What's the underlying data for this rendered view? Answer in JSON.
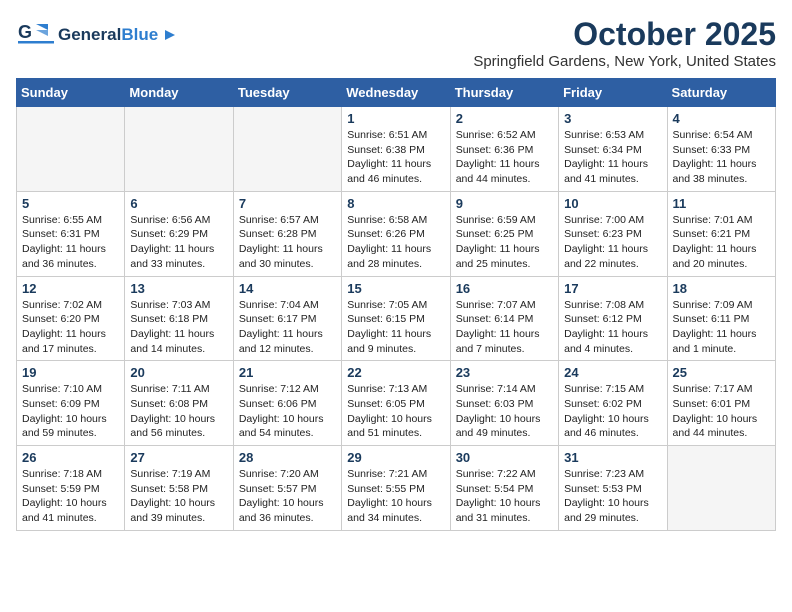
{
  "header": {
    "logo_line1": "General",
    "logo_line2": "Blue",
    "month": "October 2025",
    "location": "Springfield Gardens, New York, United States"
  },
  "weekdays": [
    "Sunday",
    "Monday",
    "Tuesday",
    "Wednesday",
    "Thursday",
    "Friday",
    "Saturday"
  ],
  "weeks": [
    [
      {
        "day": "",
        "info": ""
      },
      {
        "day": "",
        "info": ""
      },
      {
        "day": "",
        "info": ""
      },
      {
        "day": "1",
        "info": "Sunrise: 6:51 AM\nSunset: 6:38 PM\nDaylight: 11 hours\nand 46 minutes."
      },
      {
        "day": "2",
        "info": "Sunrise: 6:52 AM\nSunset: 6:36 PM\nDaylight: 11 hours\nand 44 minutes."
      },
      {
        "day": "3",
        "info": "Sunrise: 6:53 AM\nSunset: 6:34 PM\nDaylight: 11 hours\nand 41 minutes."
      },
      {
        "day": "4",
        "info": "Sunrise: 6:54 AM\nSunset: 6:33 PM\nDaylight: 11 hours\nand 38 minutes."
      }
    ],
    [
      {
        "day": "5",
        "info": "Sunrise: 6:55 AM\nSunset: 6:31 PM\nDaylight: 11 hours\nand 36 minutes."
      },
      {
        "day": "6",
        "info": "Sunrise: 6:56 AM\nSunset: 6:29 PM\nDaylight: 11 hours\nand 33 minutes."
      },
      {
        "day": "7",
        "info": "Sunrise: 6:57 AM\nSunset: 6:28 PM\nDaylight: 11 hours\nand 30 minutes."
      },
      {
        "day": "8",
        "info": "Sunrise: 6:58 AM\nSunset: 6:26 PM\nDaylight: 11 hours\nand 28 minutes."
      },
      {
        "day": "9",
        "info": "Sunrise: 6:59 AM\nSunset: 6:25 PM\nDaylight: 11 hours\nand 25 minutes."
      },
      {
        "day": "10",
        "info": "Sunrise: 7:00 AM\nSunset: 6:23 PM\nDaylight: 11 hours\nand 22 minutes."
      },
      {
        "day": "11",
        "info": "Sunrise: 7:01 AM\nSunset: 6:21 PM\nDaylight: 11 hours\nand 20 minutes."
      }
    ],
    [
      {
        "day": "12",
        "info": "Sunrise: 7:02 AM\nSunset: 6:20 PM\nDaylight: 11 hours\nand 17 minutes."
      },
      {
        "day": "13",
        "info": "Sunrise: 7:03 AM\nSunset: 6:18 PM\nDaylight: 11 hours\nand 14 minutes."
      },
      {
        "day": "14",
        "info": "Sunrise: 7:04 AM\nSunset: 6:17 PM\nDaylight: 11 hours\nand 12 minutes."
      },
      {
        "day": "15",
        "info": "Sunrise: 7:05 AM\nSunset: 6:15 PM\nDaylight: 11 hours\nand 9 minutes."
      },
      {
        "day": "16",
        "info": "Sunrise: 7:07 AM\nSunset: 6:14 PM\nDaylight: 11 hours\nand 7 minutes."
      },
      {
        "day": "17",
        "info": "Sunrise: 7:08 AM\nSunset: 6:12 PM\nDaylight: 11 hours\nand 4 minutes."
      },
      {
        "day": "18",
        "info": "Sunrise: 7:09 AM\nSunset: 6:11 PM\nDaylight: 11 hours\nand 1 minute."
      }
    ],
    [
      {
        "day": "19",
        "info": "Sunrise: 7:10 AM\nSunset: 6:09 PM\nDaylight: 10 hours\nand 59 minutes."
      },
      {
        "day": "20",
        "info": "Sunrise: 7:11 AM\nSunset: 6:08 PM\nDaylight: 10 hours\nand 56 minutes."
      },
      {
        "day": "21",
        "info": "Sunrise: 7:12 AM\nSunset: 6:06 PM\nDaylight: 10 hours\nand 54 minutes."
      },
      {
        "day": "22",
        "info": "Sunrise: 7:13 AM\nSunset: 6:05 PM\nDaylight: 10 hours\nand 51 minutes."
      },
      {
        "day": "23",
        "info": "Sunrise: 7:14 AM\nSunset: 6:03 PM\nDaylight: 10 hours\nand 49 minutes."
      },
      {
        "day": "24",
        "info": "Sunrise: 7:15 AM\nSunset: 6:02 PM\nDaylight: 10 hours\nand 46 minutes."
      },
      {
        "day": "25",
        "info": "Sunrise: 7:17 AM\nSunset: 6:01 PM\nDaylight: 10 hours\nand 44 minutes."
      }
    ],
    [
      {
        "day": "26",
        "info": "Sunrise: 7:18 AM\nSunset: 5:59 PM\nDaylight: 10 hours\nand 41 minutes."
      },
      {
        "day": "27",
        "info": "Sunrise: 7:19 AM\nSunset: 5:58 PM\nDaylight: 10 hours\nand 39 minutes."
      },
      {
        "day": "28",
        "info": "Sunrise: 7:20 AM\nSunset: 5:57 PM\nDaylight: 10 hours\nand 36 minutes."
      },
      {
        "day": "29",
        "info": "Sunrise: 7:21 AM\nSunset: 5:55 PM\nDaylight: 10 hours\nand 34 minutes."
      },
      {
        "day": "30",
        "info": "Sunrise: 7:22 AM\nSunset: 5:54 PM\nDaylight: 10 hours\nand 31 minutes."
      },
      {
        "day": "31",
        "info": "Sunrise: 7:23 AM\nSunset: 5:53 PM\nDaylight: 10 hours\nand 29 minutes."
      },
      {
        "day": "",
        "info": ""
      }
    ]
  ]
}
